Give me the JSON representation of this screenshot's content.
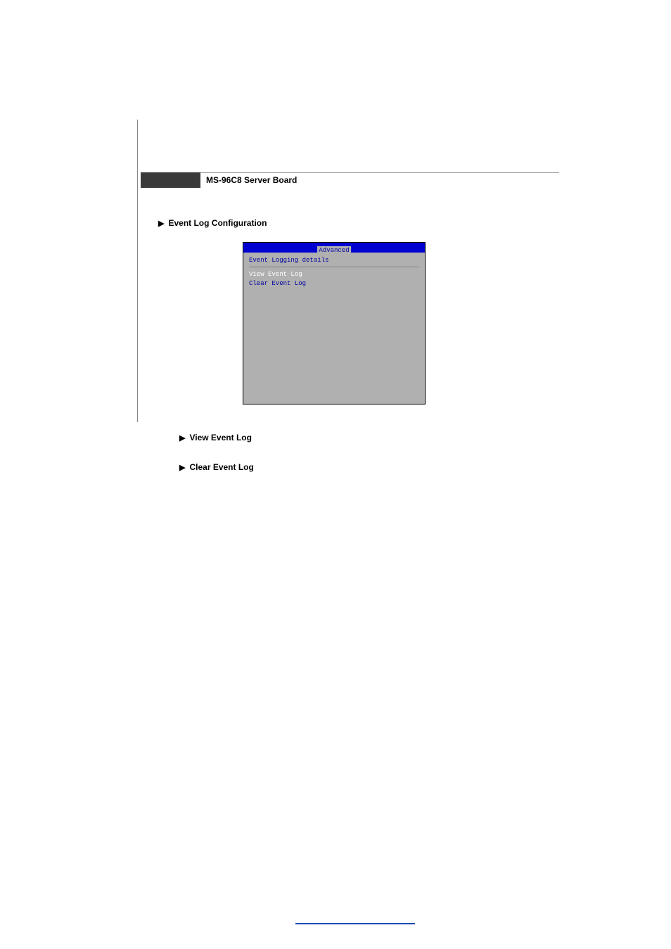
{
  "header": {
    "title": "MS-96C8 Server Board"
  },
  "section": {
    "title": "Event Log Configuration",
    "arrow": "▶"
  },
  "bios": {
    "tab": "Advanced",
    "panel_title": "Event Logging details",
    "items": [
      {
        "label": "View Event Log",
        "selected": true
      },
      {
        "label": "Clear Event Log",
        "selected": false
      }
    ]
  },
  "sub_items": [
    {
      "label": "View Event Log",
      "arrow": "▶"
    },
    {
      "label": "Clear Event Log",
      "arrow": "▶"
    }
  ]
}
